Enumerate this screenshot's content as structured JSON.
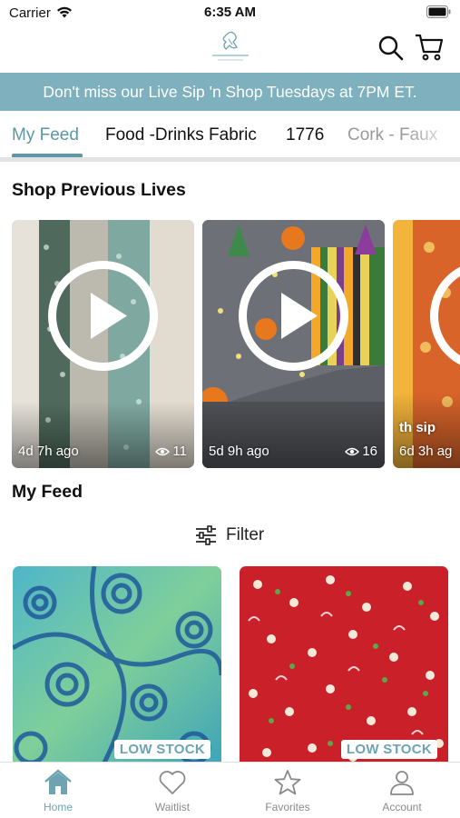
{
  "status_bar": {
    "carrier": "Carrier",
    "time": "6:35 AM"
  },
  "header": {
    "logo_icon": "brand-logo",
    "search_icon": "search-icon",
    "cart_icon": "cart-icon"
  },
  "banner": {
    "text": "Don't miss our Live Sip 'n Shop Tuesdays at 7PM ET."
  },
  "tabs": [
    {
      "label": "My Feed",
      "active": true
    },
    {
      "label": "Food -Drinks Fabric"
    },
    {
      "label": "1776"
    },
    {
      "label": "Cork - Faux"
    }
  ],
  "sections": {
    "lives_title": "Shop Previous Lives",
    "feed_title": "My Feed"
  },
  "lives": [
    {
      "ago": "4d 7h ago",
      "views": "11"
    },
    {
      "ago": "5d 9h ago",
      "views": "16"
    },
    {
      "title": "th sip",
      "ago": "6d 3h ag"
    }
  ],
  "filter": {
    "label": "Filter"
  },
  "products": [
    {
      "badge": "LOW STOCK"
    },
    {
      "badge": "LOW STOCK"
    }
  ],
  "bottom_nav": [
    {
      "label": "Home",
      "icon": "home-icon",
      "active": true
    },
    {
      "label": "Waitlist",
      "icon": "heart-icon"
    },
    {
      "label": "Favorites",
      "icon": "star-icon"
    },
    {
      "label": "Account",
      "icon": "account-icon"
    }
  ],
  "colors": {
    "accent": "#6ea3b2",
    "banner": "#7fb0bd"
  }
}
